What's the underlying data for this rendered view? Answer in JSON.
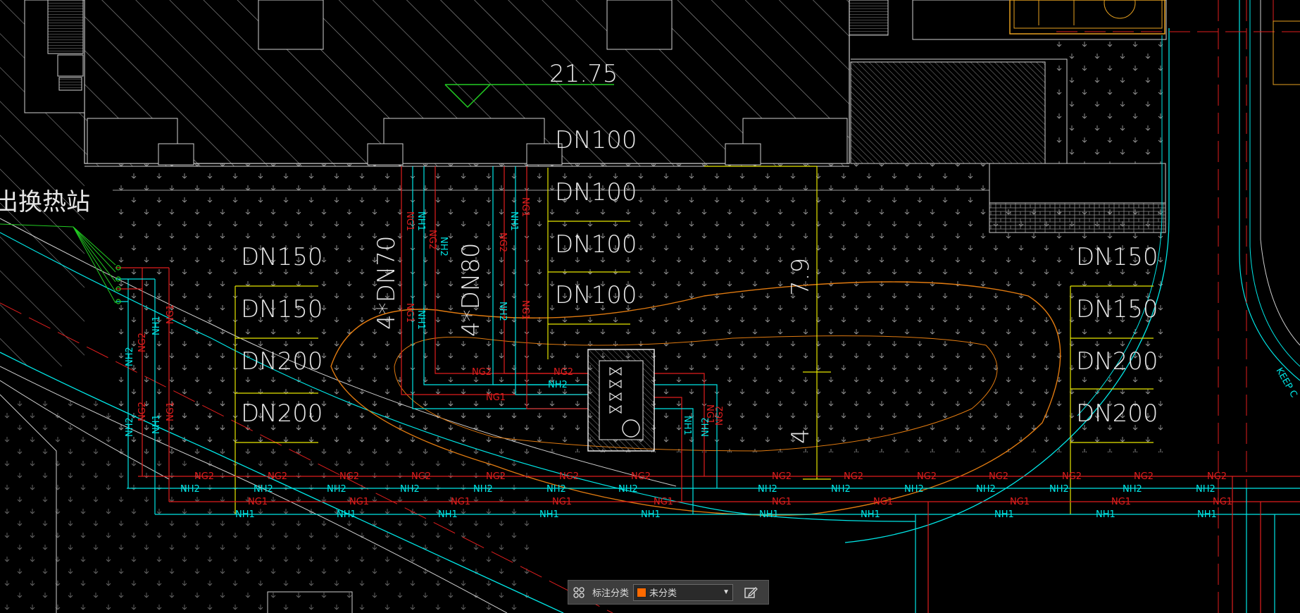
{
  "drawing": {
    "elevation": "21.75",
    "station_label": "出换热站",
    "pipe_sizes_top": [
      "DN100",
      "DN100",
      "DN100",
      "DN100"
    ],
    "pipe_sizes_left": [
      "DN150",
      "DN150",
      "DN200",
      "DN200"
    ],
    "pipe_sizes_right": [
      "DN150",
      "DN150",
      "DN200",
      "DN200"
    ],
    "bundle_70": "4*DN70",
    "bundle_80": "4*DN80",
    "dim_vertical_1": "7.9",
    "dim_vertical_2": "4",
    "keep_text": "KEEP C",
    "pipe_tags": {
      "ng1": "NG1",
      "ng2": "NG2",
      "nh1": "NH1",
      "nh2": "NH2"
    }
  },
  "colors": {
    "background": "#000000",
    "cyan": "#00e6e6",
    "red": "#e01e1e",
    "yellow": "#e6e600",
    "green": "#22cc22",
    "orange": "#e07a10",
    "white": "#e6e6e6",
    "hatch": "#bdbdbd"
  },
  "toolbar": {
    "label": "标注分类",
    "select_value": "未分类",
    "swatch_color": "#ff6a00",
    "grid_icon": "grid-icon",
    "edit_icon": "edit-icon"
  }
}
